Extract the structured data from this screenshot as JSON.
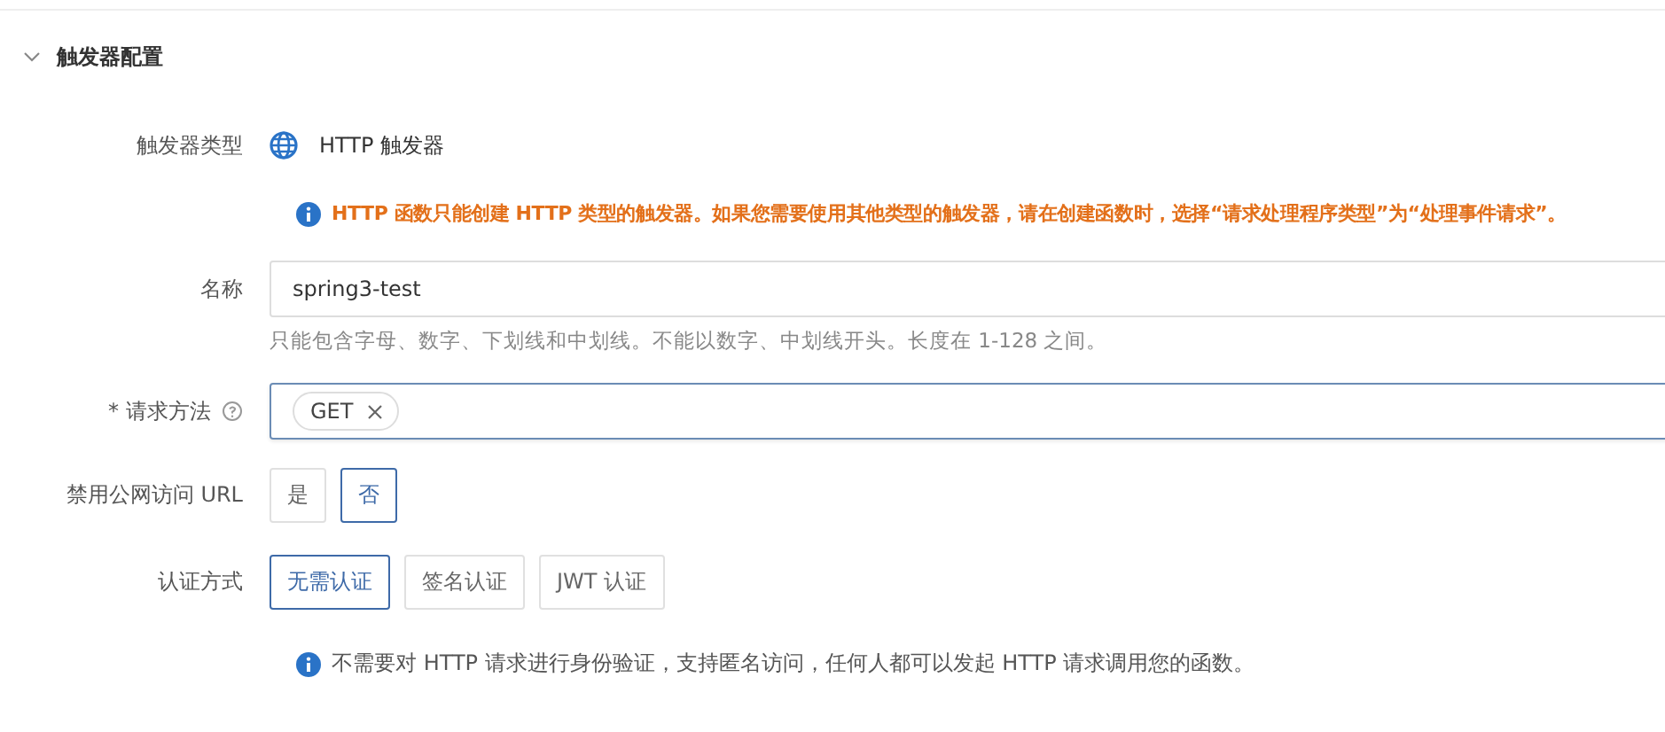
{
  "section": {
    "title": "触发器配置",
    "expanded": true
  },
  "trigger_type": {
    "label": "触发器类型",
    "value": "HTTP 触发器"
  },
  "warning": "HTTP 函数只能创建 HTTP 类型的触发器。如果您需要使用其他类型的触发器，请在创建函数时，选择“请求处理程序类型”为“处理事件请求”。",
  "name": {
    "label": "名称",
    "value": "spring3-test",
    "hint": "只能包含字母、数字、下划线和中划线。不能以数字、中划线开头。长度在 1-128 之间。"
  },
  "method": {
    "label": "请求方法",
    "required_mark": "*",
    "tags": [
      {
        "label": "GET"
      }
    ]
  },
  "disable_url": {
    "label": "禁用公网访问 URL",
    "options": [
      {
        "label": "是",
        "selected": false
      },
      {
        "label": "否",
        "selected": true
      }
    ]
  },
  "auth": {
    "label": "认证方式",
    "options": [
      {
        "label": "无需认证",
        "selected": true
      },
      {
        "label": "签名认证",
        "selected": false
      },
      {
        "label": "JWT 认证",
        "selected": false
      }
    ],
    "note": "不需要对 HTTP 请求进行身份验证，支持匿名访问，任何人都可以发起 HTTP 请求调用您的函数。"
  }
}
